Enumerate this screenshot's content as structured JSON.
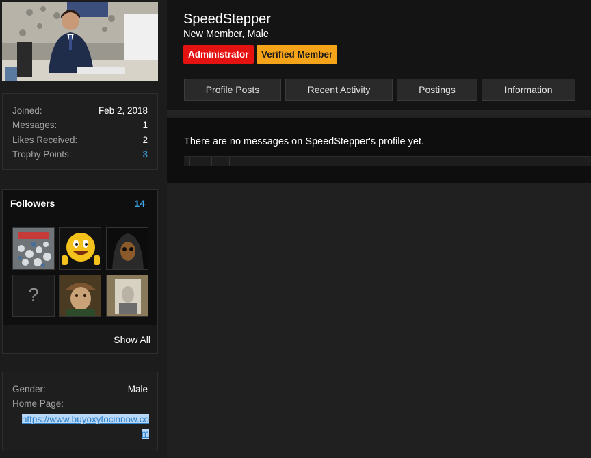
{
  "profile": {
    "username": "SpeedStepper",
    "user_title": "New Member, Male",
    "banners": [
      "Administrator",
      "Verified Member"
    ]
  },
  "tabs": [
    "Profile Posts",
    "Recent Activity",
    "Postings",
    "Information"
  ],
  "stats": [
    {
      "label": "Joined:",
      "value": "Feb 2, 2018"
    },
    {
      "label": "Messages:",
      "value": "1"
    },
    {
      "label": "Likes Received:",
      "value": "2"
    },
    {
      "label": "Trophy Points:",
      "value": "3"
    }
  ],
  "followers": {
    "title": "Followers",
    "count": "14",
    "show_all": "Show All",
    "placeholder_glyph": "?"
  },
  "about": {
    "gender_label": "Gender:",
    "gender_value": "Male",
    "homepage_label": "Home Page:",
    "homepage_url": "https://www.buyoxytocinnow.com"
  },
  "messages": {
    "empty_text": "There are no messages on SpeedStepper's profile yet."
  },
  "colors": {
    "administrator_banner": "#e51212",
    "verified_banner": "#f5a319",
    "accent": "#3ea6e6"
  }
}
